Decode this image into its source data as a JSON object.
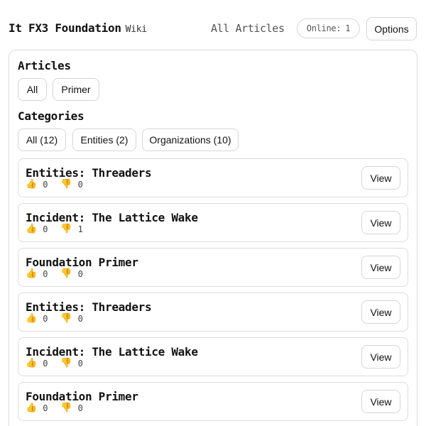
{
  "header": {
    "title": "It FX3 Foundation",
    "subtitle": "Wiki",
    "all_articles_label": "All Articles",
    "online_label": "Online:",
    "online_count": "1",
    "options_label": "Options"
  },
  "articles_section": {
    "title": "Articles",
    "filters": [
      "All",
      "Primer"
    ]
  },
  "categories_section": {
    "title": "Categories",
    "filters": [
      "All (12)",
      "Entities (2)",
      "Organizations (10)"
    ]
  },
  "icons": {
    "thumbs_up": "thumbs-up-icon",
    "thumbs_down": "thumbs-down-icon"
  },
  "articles": [
    {
      "title": "Entities: Threaders",
      "upvotes": "0",
      "downvotes": "0",
      "view_label": "View"
    },
    {
      "title": "Incident: The Lattice Wake",
      "upvotes": "0",
      "downvotes": "1",
      "view_label": "View"
    },
    {
      "title": "Foundation Primer",
      "upvotes": "0",
      "downvotes": "0",
      "view_label": "View"
    },
    {
      "title": "Entities: Threaders",
      "upvotes": "0",
      "downvotes": "0",
      "view_label": "View"
    },
    {
      "title": "Incident: The Lattice Wake",
      "upvotes": "0",
      "downvotes": "0",
      "view_label": "View"
    },
    {
      "title": "Foundation Primer",
      "upvotes": "0",
      "downvotes": "0",
      "view_label": "View"
    }
  ]
}
